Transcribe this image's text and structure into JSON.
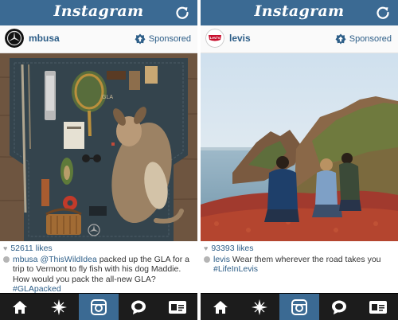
{
  "app": {
    "brand_name": "Instagram"
  },
  "colors": {
    "topbar": "#3b6a93",
    "link": "#2c5d87",
    "tabbar": "#1c1c1c"
  },
  "posts": [
    {
      "username": "mbusa",
      "sponsored_label": "Sponsored",
      "likes": "52611 likes",
      "caption_user": "mbusa",
      "caption_mention": "@ThisWildIdea",
      "caption_text": " packed up the GLA for a trip to Vermont to fly fish with his dog Maddie. How would you pack the all-new GLA?",
      "caption_hashtag": "#GLApacked",
      "photo_label": "GLA",
      "avatar_icon": "mercedes-star-logo"
    },
    {
      "username": "levis",
      "sponsored_label": "Sponsored",
      "likes": "93393 likes",
      "caption_user": "levis",
      "caption_text": " Wear them wherever the road takes you",
      "caption_hashtag": "#LifeInLevis",
      "avatar_text": "Levi's",
      "avatar_icon": "levis-batwing-logo"
    }
  ],
  "tabs": [
    {
      "icon": "home-icon",
      "active": false
    },
    {
      "icon": "explore-star-icon",
      "active": false
    },
    {
      "icon": "camera-icon",
      "active": true
    },
    {
      "icon": "activity-bubble-icon",
      "active": false
    },
    {
      "icon": "profile-card-icon",
      "active": false
    }
  ]
}
